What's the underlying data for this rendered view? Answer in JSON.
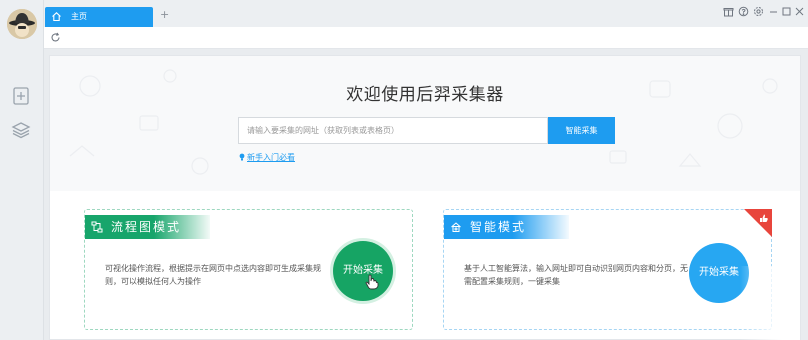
{
  "tabs": [
    {
      "label": "主页",
      "icon": "home-icon",
      "active": true
    }
  ],
  "new_tab": {
    "label": "+"
  },
  "window_controls": [
    "gift-icon",
    "help-icon",
    "settings-icon",
    "minimize-icon",
    "maximize-icon",
    "close-icon"
  ],
  "sidebar": {
    "items": [
      {
        "icon": "add-task-icon"
      },
      {
        "icon": "layers-icon"
      }
    ]
  },
  "hero": {
    "headline": "欢迎使用后羿采集器",
    "search_placeholder": "请输入要采集的网址（获取列表或表格页）",
    "search_button": "智能采集",
    "guide_link": "新手入门必看"
  },
  "cards": {
    "flow": {
      "title": "流程图模式",
      "description": "可视化操作流程，根据提示在网页中点选内容即可生成采集规则，可以模拟任何人为操作",
      "button": "开始采集"
    },
    "smart": {
      "title": "智能模式",
      "description": "基于人工智能算法，输入网址即可自动识别网页内容和分页，无需配置采集规则，一键采集",
      "button": "开始采集",
      "badge_icon": "thumbs-up-icon"
    }
  },
  "colors": {
    "primary": "#1e9cf0",
    "flow_green": "#16a464",
    "badge_red": "#e8453c"
  }
}
